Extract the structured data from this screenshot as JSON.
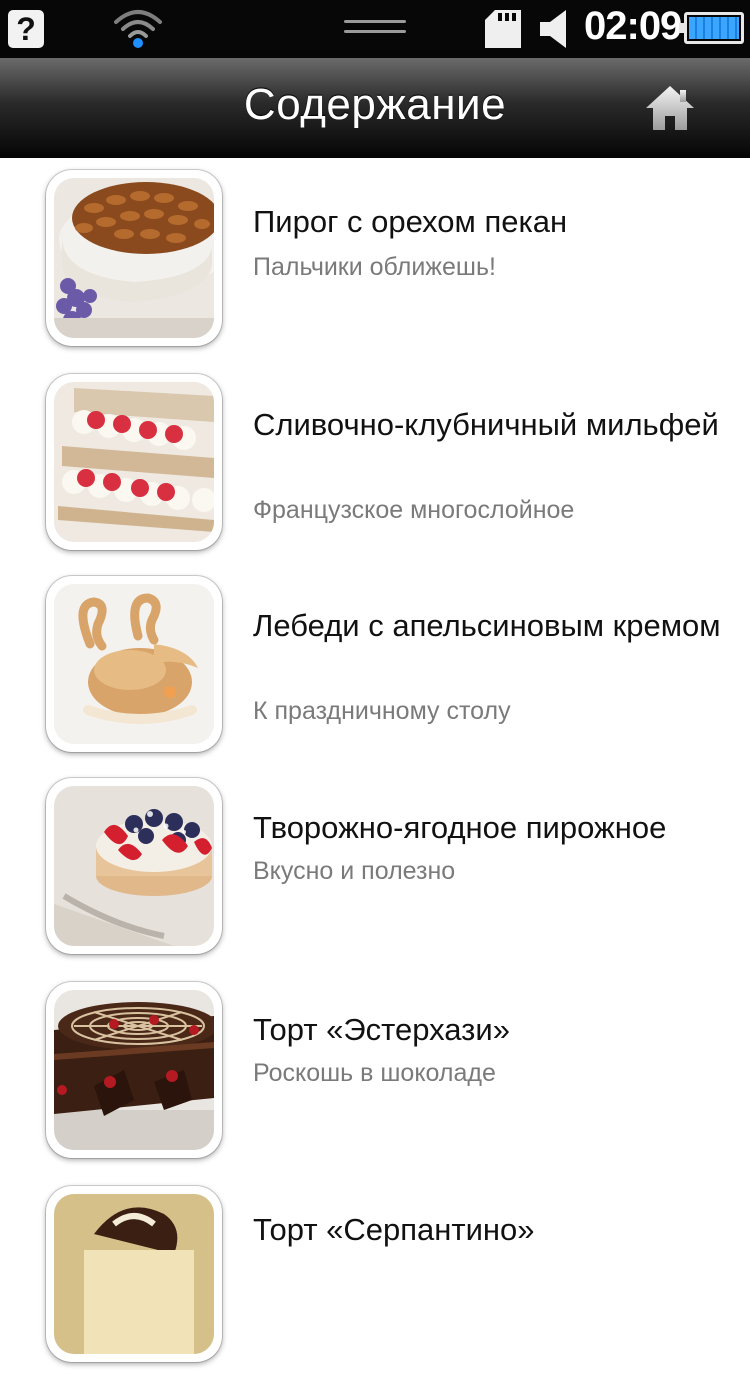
{
  "status_bar": {
    "time": "02:09",
    "help_glyph": "?",
    "icons": [
      "help-icon",
      "wifi-icon",
      "drag-handle-icon",
      "sd-card-icon",
      "volume-icon",
      "battery-icon"
    ]
  },
  "header": {
    "title": "Содержание",
    "home_icon": "home-icon"
  },
  "recipes": [
    {
      "title": "Пирог с орехом пекан",
      "subtitle": "Пальчики оближешь!"
    },
    {
      "title": "Сливочно-клубничный мильфей",
      "subtitle": "Французское многослойное"
    },
    {
      "title": "Лебеди с апельсиновым кремом",
      "subtitle": "К праздничному столу"
    },
    {
      "title": "Творожно-ягодное пирожное",
      "subtitle": "Вкусно и полезно"
    },
    {
      "title": "Торт «Эстерхази»",
      "subtitle": "Роскошь в шоколаде"
    },
    {
      "title": "Торт «Серпантино»",
      "subtitle": ""
    }
  ],
  "colors": {
    "status_bar_bg": "#070707",
    "title_bar_gradient_top": "#6b6b6b",
    "title_bar_gradient_bottom": "#050505",
    "title_text": "#ffffff",
    "item_title": "#111111",
    "item_subtitle": "#7a7a7a",
    "battery": "#3aa6ff"
  }
}
